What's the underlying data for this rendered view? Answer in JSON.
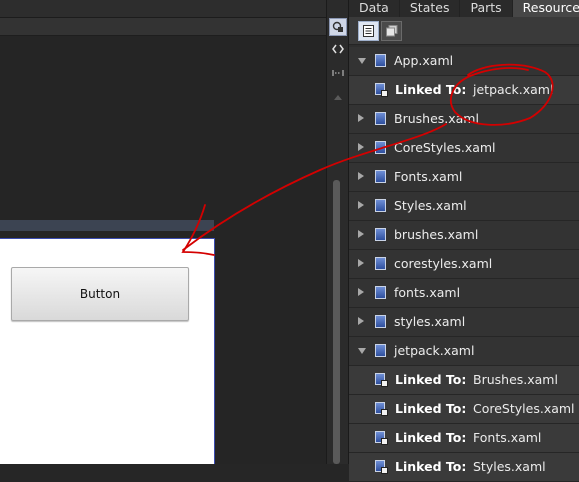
{
  "tabs": [
    {
      "label": "Data",
      "active": false
    },
    {
      "label": "States",
      "active": false
    },
    {
      "label": "Parts",
      "active": false
    },
    {
      "label": "Resources",
      "active": true
    }
  ],
  "canvas": {
    "button_label": "Button"
  },
  "tree": {
    "app": {
      "label": "App.xaml",
      "linked_key": "Linked To:",
      "linked_value": "jetpack.xaml"
    },
    "resources": [
      "Brushes.xaml",
      "CoreStyles.xaml",
      "Fonts.xaml",
      "Styles.xaml",
      "brushes.xaml",
      "corestyles.xaml",
      "fonts.xaml",
      "styles.xaml"
    ],
    "jetpack": {
      "label": "jetpack.xaml",
      "linked": [
        {
          "key": "Linked To:",
          "value": "Brushes.xaml"
        },
        {
          "key": "Linked To:",
          "value": "CoreStyles.xaml"
        },
        {
          "key": "Linked To:",
          "value": "Fonts.xaml"
        },
        {
          "key": "Linked To:",
          "value": "Styles.xaml"
        }
      ]
    }
  },
  "icons": {
    "arrow_collapsed": "triangle-right-icon",
    "arrow_expanded": "triangle-down-icon",
    "resource_file": "xaml-file-icon",
    "linked_file": "linked-file-icon"
  },
  "colors": {
    "panel_bg": "#2e2e2e",
    "tab_active": "#474747",
    "canvas_bg": "#252525",
    "annotation": "#d40000",
    "artboard_border": "#3a4bb0"
  }
}
